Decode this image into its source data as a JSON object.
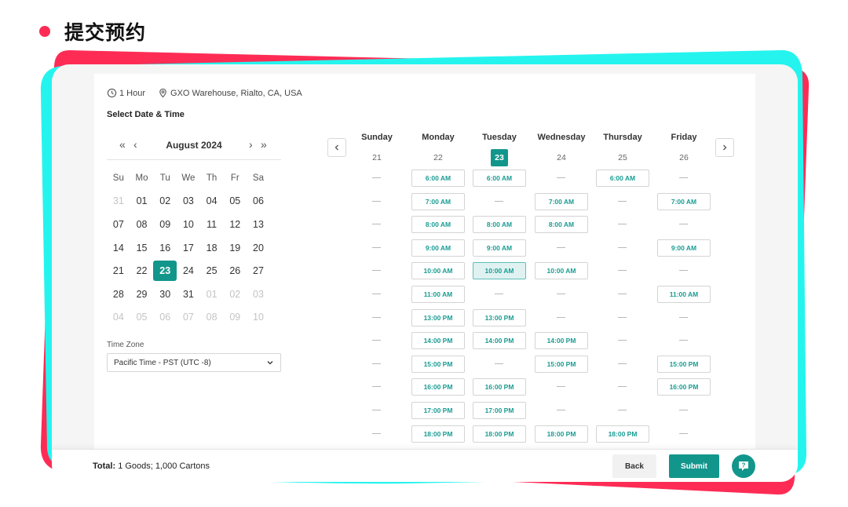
{
  "page_heading": "提交预约",
  "colors": {
    "accent": "#12968c",
    "brand_red": "#fe2c55",
    "brand_cyan": "#25f4ee"
  },
  "meta": {
    "duration": "1 Hour",
    "location": "GXO Warehouse, Rialto, CA, USA"
  },
  "section_title": "Select Date & Time",
  "calendar": {
    "month_label": "August 2024",
    "weekdays": [
      "Su",
      "Mo",
      "Tu",
      "We",
      "Th",
      "Fr",
      "Sa"
    ],
    "weeks": [
      [
        {
          "d": "31",
          "o": true
        },
        {
          "d": "01"
        },
        {
          "d": "02"
        },
        {
          "d": "03"
        },
        {
          "d": "04"
        },
        {
          "d": "05"
        },
        {
          "d": "06"
        }
      ],
      [
        {
          "d": "07"
        },
        {
          "d": "08"
        },
        {
          "d": "09"
        },
        {
          "d": "10"
        },
        {
          "d": "11"
        },
        {
          "d": "12"
        },
        {
          "d": "13"
        }
      ],
      [
        {
          "d": "14"
        },
        {
          "d": "15"
        },
        {
          "d": "16"
        },
        {
          "d": "17"
        },
        {
          "d": "18"
        },
        {
          "d": "19"
        },
        {
          "d": "20"
        }
      ],
      [
        {
          "d": "21"
        },
        {
          "d": "22"
        },
        {
          "d": "23",
          "s": true
        },
        {
          "d": "24"
        },
        {
          "d": "25"
        },
        {
          "d": "26"
        },
        {
          "d": "27"
        }
      ],
      [
        {
          "d": "28"
        },
        {
          "d": "29"
        },
        {
          "d": "30"
        },
        {
          "d": "31"
        },
        {
          "d": "01",
          "o": true
        },
        {
          "d": "02",
          "o": true
        },
        {
          "d": "03",
          "o": true
        }
      ],
      [
        {
          "d": "04",
          "o": true
        },
        {
          "d": "05",
          "o": true
        },
        {
          "d": "06",
          "o": true
        },
        {
          "d": "07",
          "o": true
        },
        {
          "d": "08",
          "o": true
        },
        {
          "d": "09",
          "o": true
        },
        {
          "d": "10",
          "o": true
        }
      ]
    ]
  },
  "timezone": {
    "label": "Time Zone",
    "value": "Pacific Time - PST (UTC -8)"
  },
  "week_days": [
    {
      "name": "Sunday",
      "num": "21"
    },
    {
      "name": "Monday",
      "num": "22"
    },
    {
      "name": "Tuesday",
      "num": "23",
      "selected": true
    },
    {
      "name": "Wednesday",
      "num": "24"
    },
    {
      "name": "Thursday",
      "num": "25"
    },
    {
      "name": "Friday",
      "num": "26"
    }
  ],
  "slot_rows": [
    [
      "",
      "6:00 AM",
      "6:00 AM",
      "",
      "6:00 AM",
      ""
    ],
    [
      "",
      "7:00 AM",
      "",
      "7:00 AM",
      "",
      "7:00 AM"
    ],
    [
      "",
      "8:00 AM",
      "8:00 AM",
      "8:00 AM",
      "",
      ""
    ],
    [
      "",
      "9:00 AM",
      "9:00 AM",
      "",
      "",
      "9:00 AM"
    ],
    [
      "",
      "10:00 AM",
      "10:00 AM",
      "10:00 AM",
      "",
      ""
    ],
    [
      "",
      "11:00 AM",
      "",
      "",
      "",
      "11:00 AM"
    ],
    [
      "",
      "13:00 PM",
      "13:00 PM",
      "",
      "",
      ""
    ],
    [
      "",
      "14:00 PM",
      "14:00 PM",
      "14:00 PM",
      "",
      ""
    ],
    [
      "",
      "15:00 PM",
      "",
      "15:00 PM",
      "",
      "15:00 PM"
    ],
    [
      "",
      "16:00 PM",
      "16:00 PM",
      "",
      "",
      "16:00 PM"
    ],
    [
      "",
      "17:00 PM",
      "17:00 PM",
      "",
      "",
      ""
    ],
    [
      "",
      "18:00 PM",
      "18:00 PM",
      "18:00 PM",
      "18:00 PM",
      ""
    ]
  ],
  "selected_slot": {
    "day": "Tuesday",
    "time": "10:00 AM"
  },
  "footer": {
    "total_label": "Total:",
    "total_value": "1 Goods; 1,000 Cartons",
    "back_label": "Back",
    "submit_label": "Submit",
    "help_icon": "question-bubble-icon"
  }
}
